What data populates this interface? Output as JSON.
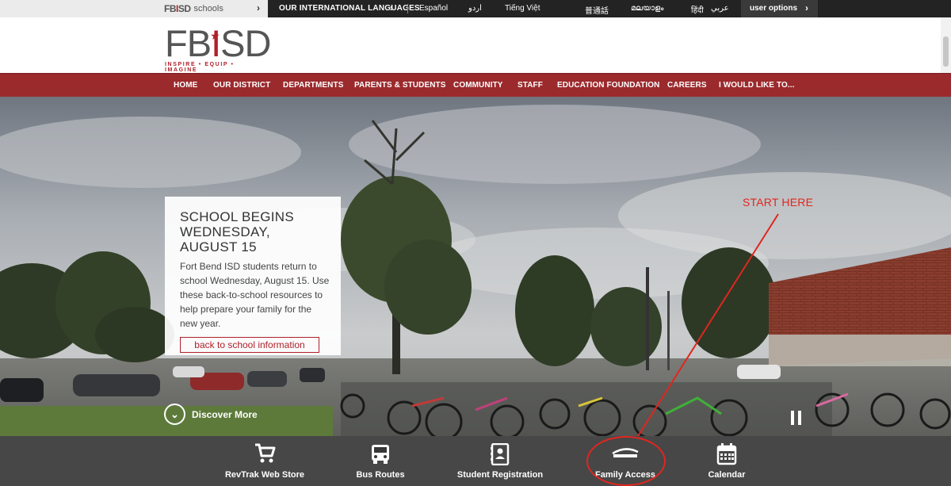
{
  "topbar": {
    "schools_logo": "FBISD",
    "schools_label": "schools",
    "languages_label": "OUR INTERNATIONAL LANGUAGES",
    "languages": [
      "Español",
      "اردو",
      "Tiếng Việt",
      "普通話",
      "മലയാളം",
      "हिंदी",
      "عربي"
    ],
    "user_options": "user options"
  },
  "logo": {
    "text": "FBISD",
    "tagline": "INSPIRE • EQUIP • IMAGINE"
  },
  "nav": {
    "items": [
      "HOME",
      "OUR DISTRICT",
      "DEPARTMENTS",
      "PARENTS & STUDENTS",
      "COMMUNITY",
      "STAFF",
      "EDUCATION FOUNDATION",
      "CAREERS",
      "I WOULD LIKE TO..."
    ]
  },
  "hero": {
    "title": "SCHOOL BEGINS WEDNESDAY, AUGUST 15",
    "body": "Fort Bend ISD students return to school Wednesday, August 15. Use these back-to-school resources to help prepare your family for the new year.",
    "button": "back to school information",
    "discover": "Discover More"
  },
  "annotation": {
    "text": "START HERE"
  },
  "quick_links": [
    "RevTrak Web Store",
    "Bus Routes",
    "Student Registration",
    "Family Access",
    "Calendar"
  ],
  "colors": {
    "brand_red": "#9b2a2d",
    "logo_red": "#b0202b",
    "annotation_red": "#e0261f",
    "topbar": "#232323"
  }
}
